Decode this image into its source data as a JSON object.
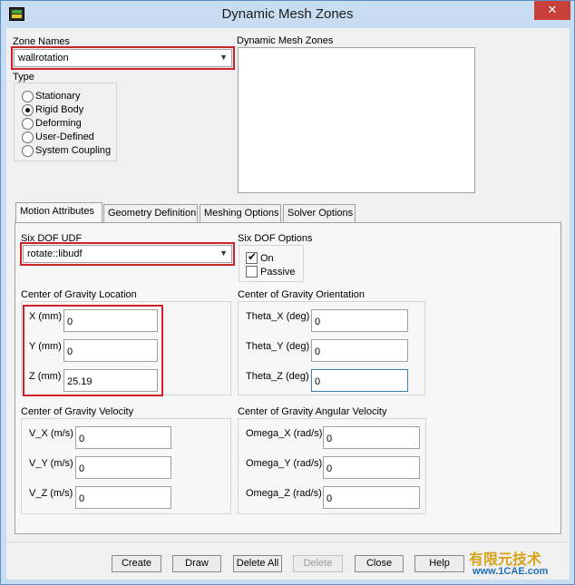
{
  "window": {
    "title": "Dynamic Mesh Zones"
  },
  "zone_names": {
    "label": "Zone Names",
    "value": "wallrotation"
  },
  "dynamic_mesh_zones": {
    "label": "Dynamic Mesh Zones",
    "items": []
  },
  "type": {
    "label": "Type",
    "options": [
      {
        "label": "Stationary",
        "checked": false
      },
      {
        "label": "Rigid Body",
        "checked": true
      },
      {
        "label": "Deforming",
        "checked": false
      },
      {
        "label": "User-Defined",
        "checked": false
      },
      {
        "label": "System Coupling",
        "checked": false
      }
    ]
  },
  "tabs": [
    {
      "label": "Motion Attributes",
      "active": true
    },
    {
      "label": "Geometry Definition",
      "active": false
    },
    {
      "label": "Meshing Options",
      "active": false
    },
    {
      "label": "Solver Options",
      "active": false
    }
  ],
  "six_dof_udf": {
    "label": "Six DOF UDF",
    "value": "rotate::libudf"
  },
  "six_dof_options": {
    "label": "Six DOF Options",
    "on": {
      "label": "On",
      "checked": true
    },
    "passive": {
      "label": "Passive",
      "checked": false
    }
  },
  "cg_location": {
    "label": "Center of Gravity Location",
    "fields": [
      {
        "label": "X (mm)",
        "value": "0"
      },
      {
        "label": "Y (mm)",
        "value": "0"
      },
      {
        "label": "Z (mm)",
        "value": "25.19"
      }
    ]
  },
  "cg_orientation": {
    "label": "Center of Gravity Orientation",
    "fields": [
      {
        "label": "Theta_X (deg)",
        "value": "0"
      },
      {
        "label": "Theta_Y (deg)",
        "value": "0"
      },
      {
        "label": "Theta_Z (deg)",
        "value": "0"
      }
    ]
  },
  "cg_velocity": {
    "label": "Center of Gravity Velocity",
    "fields": [
      {
        "label": "V_X (m/s)",
        "value": "0"
      },
      {
        "label": "V_Y (m/s)",
        "value": "0"
      },
      {
        "label": "V_Z (m/s)",
        "value": "0"
      }
    ]
  },
  "cg_angular_velocity": {
    "label": "Center of Gravity Angular Velocity",
    "fields": [
      {
        "label": "Omega_X (rad/s)",
        "value": "0"
      },
      {
        "label": "Omega_Y (rad/s)",
        "value": "0"
      },
      {
        "label": "Omega_Z (rad/s)",
        "value": "0"
      }
    ]
  },
  "buttons": {
    "create": "Create",
    "draw": "Draw",
    "delete_all": "Delete All",
    "delete": "Delete",
    "close": "Close",
    "help": "Help"
  },
  "watermark": {
    "line1": "有限元技术",
    "line2": "www.1CAE.com"
  },
  "colors": {
    "highlight": "#d0202a",
    "close_button": "#c7403a",
    "title_bar": "#c9ddf2"
  }
}
